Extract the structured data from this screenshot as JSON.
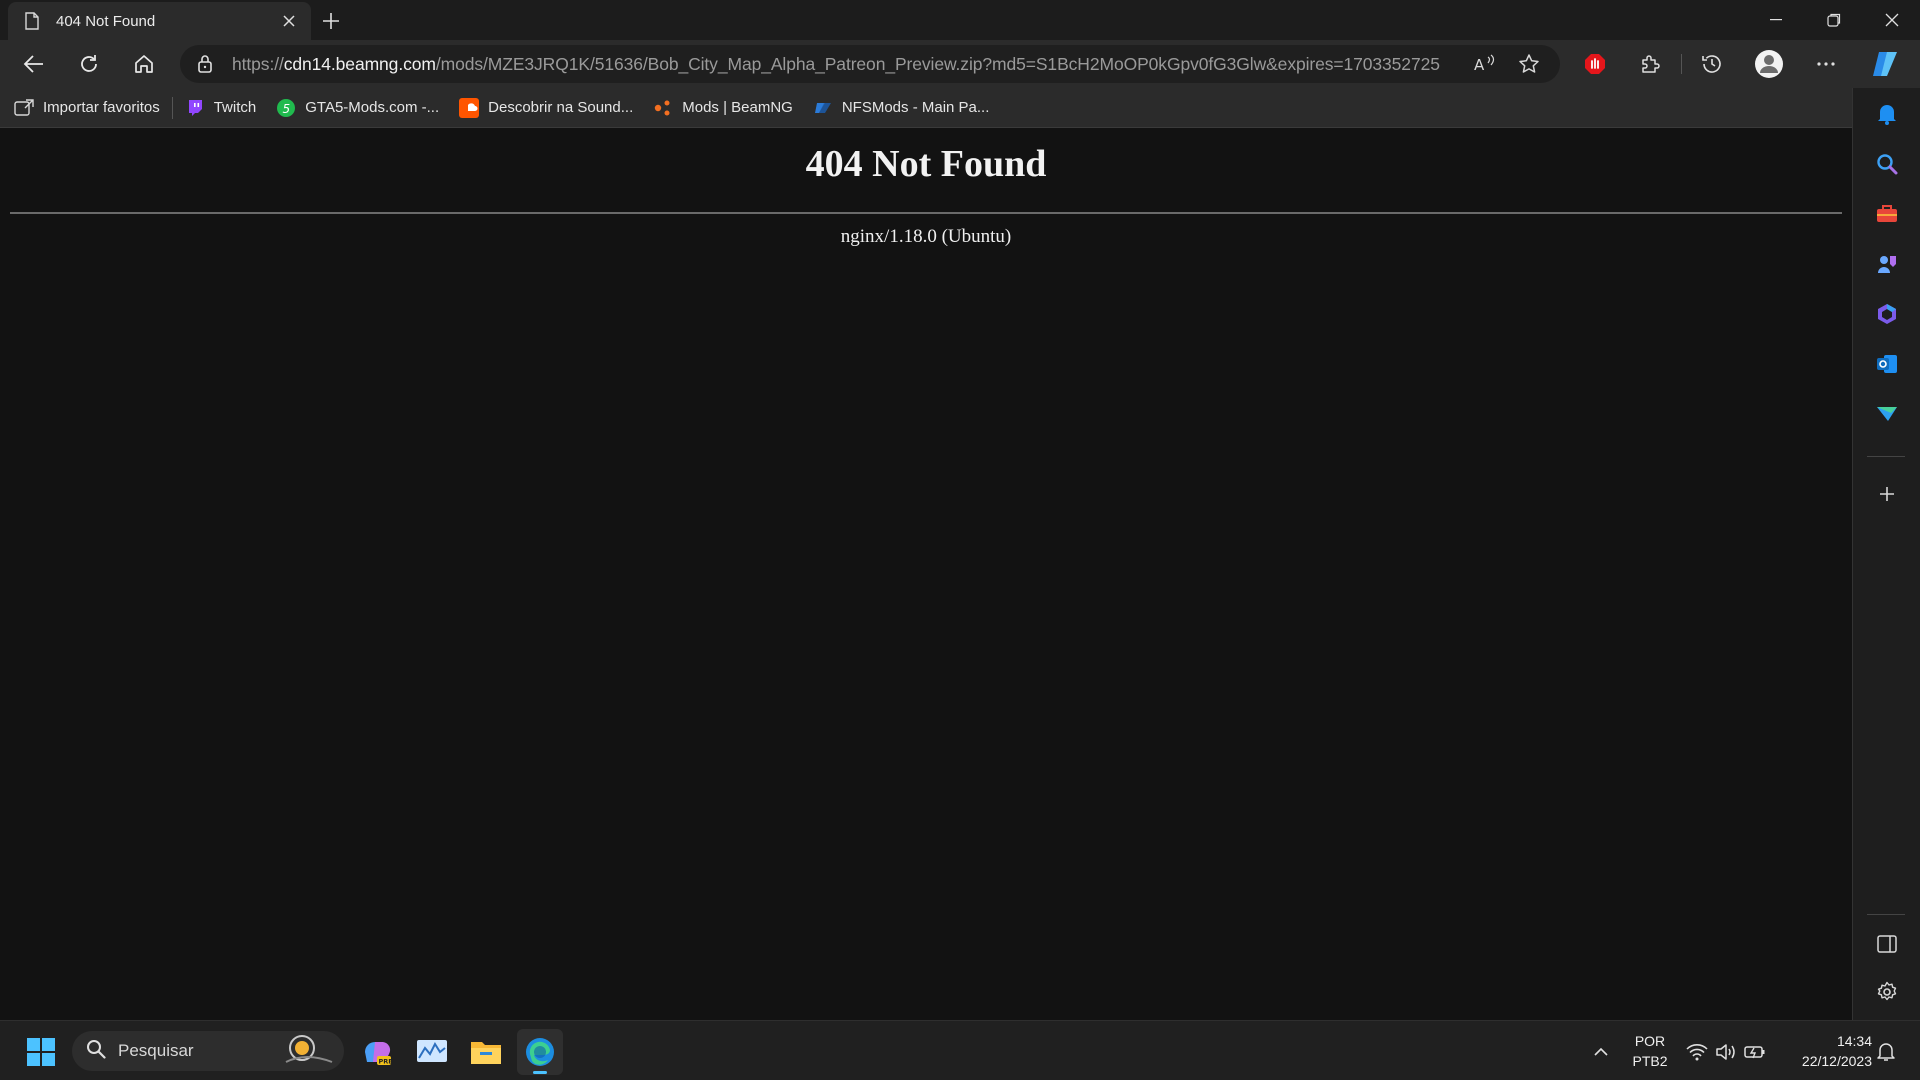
{
  "tab": {
    "title": "404 Not Found",
    "icon": "document-icon"
  },
  "address_bar": {
    "url_scheme": "https://",
    "url_host": "cdn14.beamng.com",
    "url_path": "/mods/MZE3JRQ1K/51636/Bob_City_Map_Alpha_Patreon_Preview.zip?md5=S1BcH2MoOP0kGpv0fG3Glw&expires=1703352725"
  },
  "favorites": [
    {
      "label": "Importar favoritos",
      "icon": "import-favorites-icon"
    },
    {
      "label": "Twitch",
      "icon": "twitch-icon"
    },
    {
      "label": "GTA5-Mods.com -...",
      "icon": "gta5mods-icon"
    },
    {
      "label": "Descobrir na Sound...",
      "icon": "soundcloud-icon"
    },
    {
      "label": "Mods | BeamNG",
      "icon": "beamng-icon"
    },
    {
      "label": "NFSMods - Main Pa...",
      "icon": "nfsmods-icon"
    }
  ],
  "page": {
    "heading": "404 Not Found",
    "server_info": "nginx/1.18.0 (Ubuntu)"
  },
  "taskbar": {
    "search_placeholder": "Pesquisar",
    "lang_line1": "POR",
    "lang_line2": "PTB2",
    "time": "14:34",
    "date": "22/12/2023"
  },
  "colors": {
    "page_bg": "#121212",
    "chrome_bg": "#2b2b2b",
    "accent_blue": "#3a96dd"
  }
}
